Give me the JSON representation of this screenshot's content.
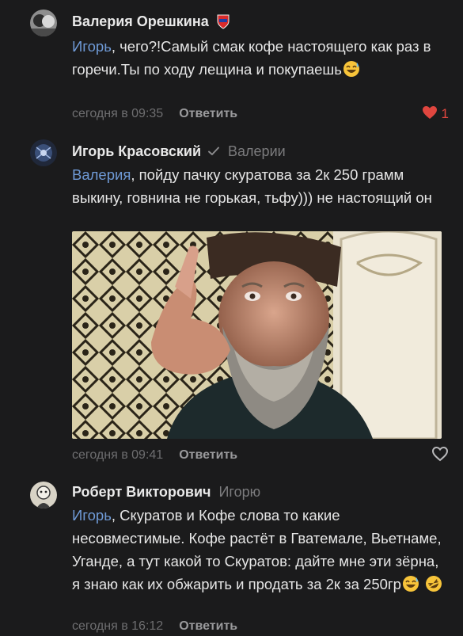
{
  "comments": [
    {
      "author": "Валерия Орешкина",
      "reply_to": "",
      "mention": "Игорь",
      "text": ", чего?!Самый смак кофе настоящего как раз в горечи.Ты по ходу лещина и покупаешь",
      "time": "сегодня в 09:35",
      "reply_label": "Ответить",
      "likes": "1",
      "liked": true
    },
    {
      "author": "Игорь Красовский",
      "reply_to": "Валерии",
      "mention": "Валерия",
      "text": ", пойду пачку скуратова за 2к 250 грамм выкину, говнина не горькая, тьфу))) не настоящий он",
      "time": "сегодня в 09:41",
      "reply_label": "Ответить",
      "liked": false
    },
    {
      "author": "Роберт Викторович",
      "reply_to": "Игорю",
      "mention": "Игорь",
      "text": ", Скуратов и Кофе слова то какие несовместимые. Кофе растёт в Гватемале, Вьетнаме, Уганде, а тут какой то Скуратов: дайте мне эти зёрна, я знаю как их обжарить и продать за 2к за 250гр",
      "time": "сегодня в 16:12",
      "reply_label": "Ответить"
    }
  ],
  "icons": {
    "verified": "check-icon",
    "like_active": "heart-filled-icon",
    "like": "heart-outline-icon",
    "emoji_laugh": "grinning-sweat-emoji",
    "emoji_rofl": "rofl-emoji"
  },
  "colors": {
    "background": "#1b1b1c",
    "mention": "#6f9ad6",
    "like_active": "#e0463f"
  }
}
